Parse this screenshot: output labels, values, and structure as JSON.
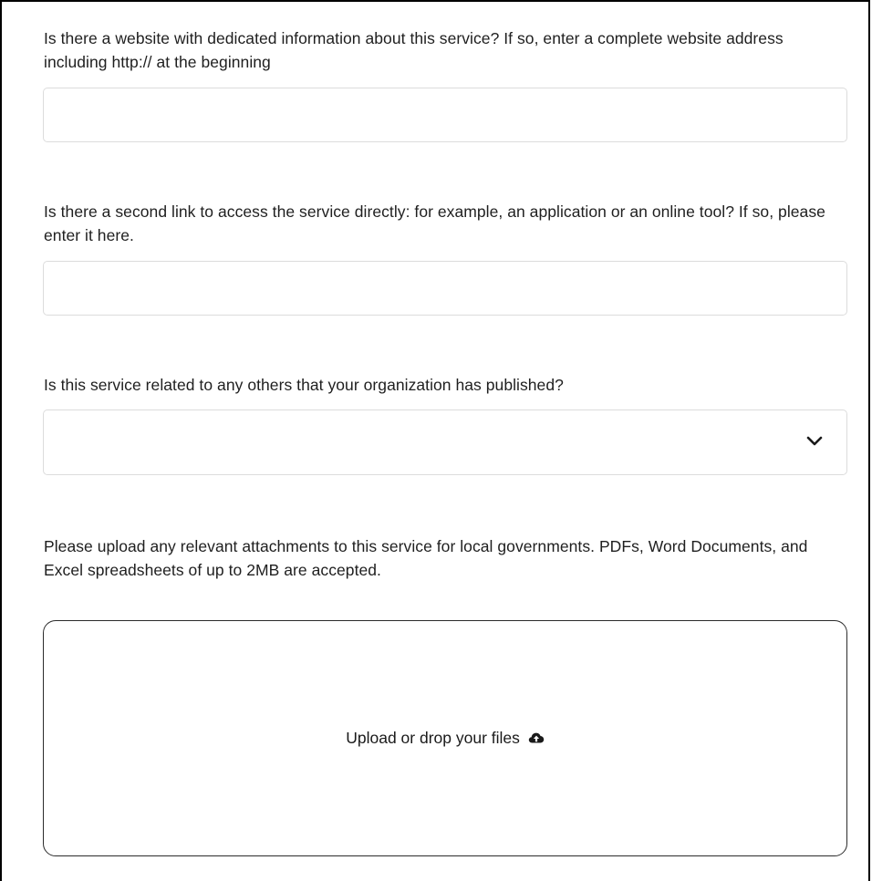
{
  "form": {
    "website": {
      "question": "Is there a website with dedicated information about this service? If so, enter a complete website address including http:// at the beginning",
      "value": "",
      "placeholder": ""
    },
    "second_link": {
      "question": "Is there a second link to access the service directly: for example, an application or an online tool? If so, please enter it here.",
      "value": "",
      "placeholder": ""
    },
    "related_services": {
      "question": "Is this service related to any others that your organization has published?",
      "selected_value": "",
      "icon": "chevron-down-icon"
    },
    "attachments": {
      "question": "Please upload any relevant attachments to this service for local governments. PDFs, Word Documents, and Excel spreadsheets of up to 2MB are accepted.",
      "upload_label": "Upload or drop your files",
      "icon": "cloud-upload-icon"
    }
  },
  "colors": {
    "border_light": "#dcdcdc",
    "border_dark": "#2b2b2b",
    "text": "#1f1f1f"
  }
}
